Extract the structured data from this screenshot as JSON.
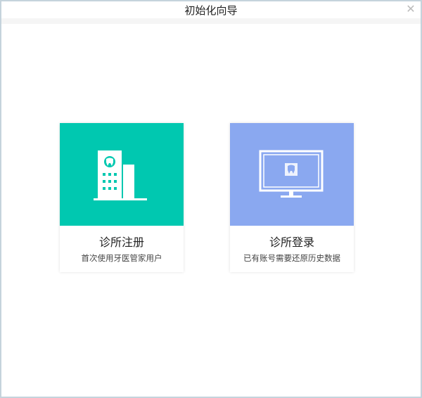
{
  "window": {
    "title": "初始化向导",
    "close_icon": "close-icon"
  },
  "colors": {
    "register": "#00c8b0",
    "login": "#8aa8f0"
  },
  "cards": [
    {
      "title": "诊所注册",
      "desc": "首次使用牙医管家用户",
      "icon": "hospital-building-icon"
    },
    {
      "title": "诊所登录",
      "desc": "已有账号需要还原历史数据",
      "icon": "monitor-tooth-icon"
    }
  ]
}
